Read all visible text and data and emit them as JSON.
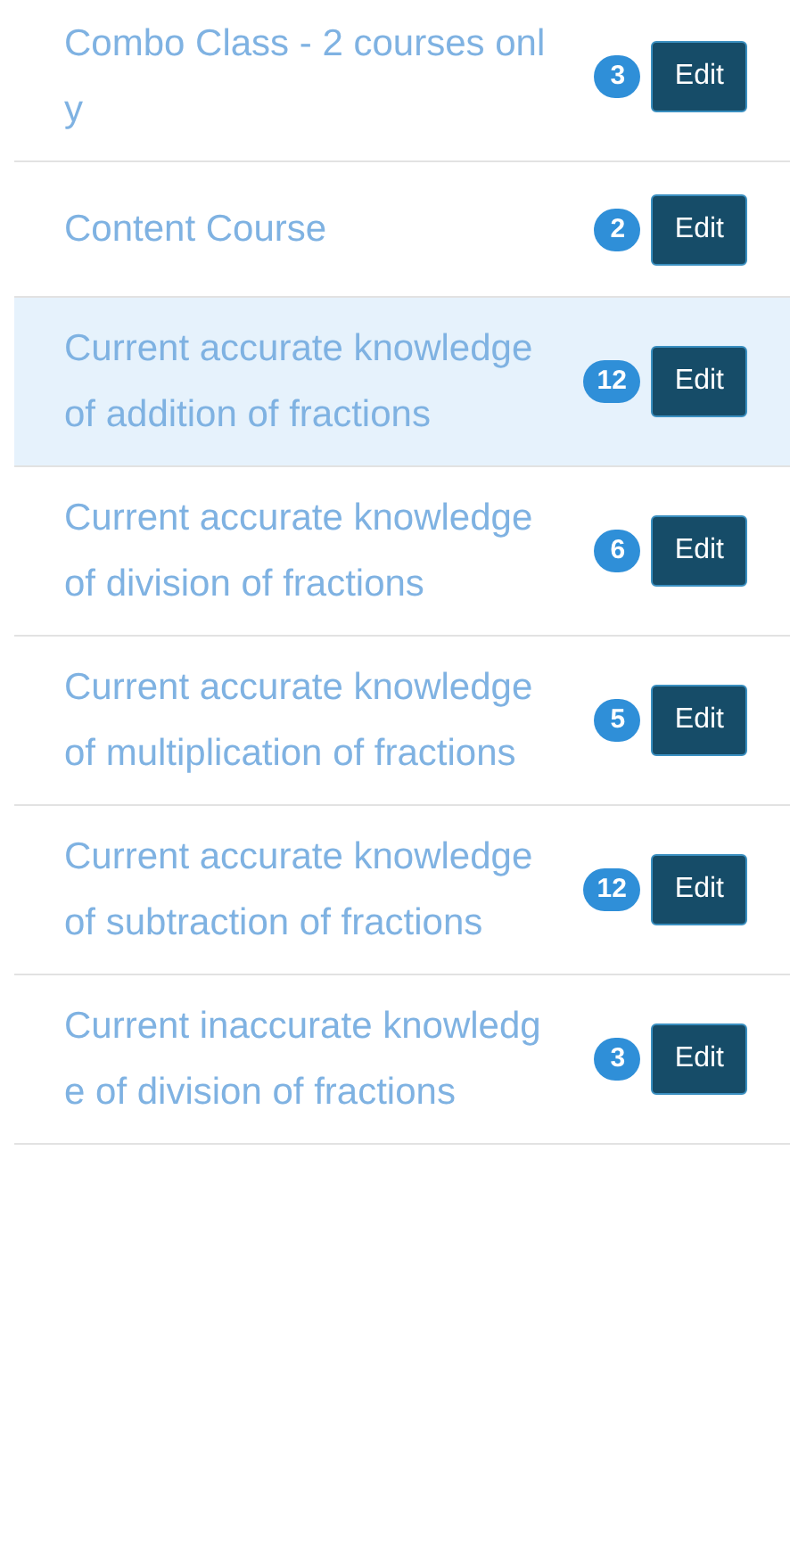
{
  "rows": [
    {
      "label": "Combo Class - 2 courses only",
      "count": "3",
      "button": "Edit",
      "selected": false
    },
    {
      "label": "Content Course",
      "count": "2",
      "button": "Edit",
      "selected": false
    },
    {
      "label": "Current accurate knowledge of addition of fractions",
      "count": "12",
      "button": "Edit",
      "selected": true
    },
    {
      "label": "Current accurate knowledge of division of fractions",
      "count": "6",
      "button": "Edit",
      "selected": false
    },
    {
      "label": "Current accurate knowledge of multiplication of fractions",
      "count": "5",
      "button": "Edit",
      "selected": false
    },
    {
      "label": "Current accurate knowledge of subtraction of fractions",
      "count": "12",
      "button": "Edit",
      "selected": false
    },
    {
      "label": "Current inaccurate knowledge of division of fractions",
      "count": "3",
      "button": "Edit",
      "selected": false
    }
  ]
}
